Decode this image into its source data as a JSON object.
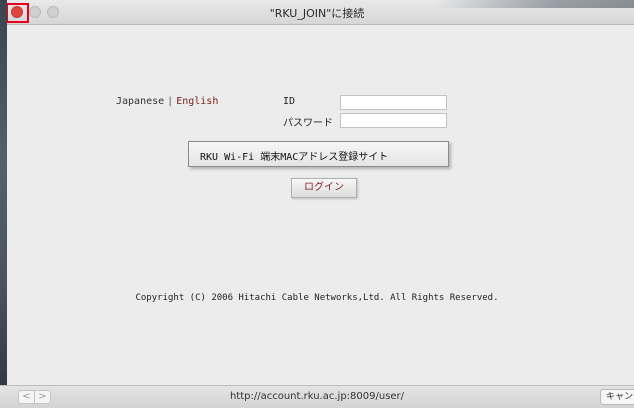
{
  "window": {
    "title": "\"RKU_JOIN\"に接続"
  },
  "language": {
    "japanese": "Japanese",
    "separator": "|",
    "english": "English"
  },
  "form": {
    "id_label": "ID",
    "password_label": "パスワード",
    "id_value": "",
    "password_value": ""
  },
  "site_select": {
    "selected": "RKU Wi-Fi 端末MACアドレス登録サイト"
  },
  "login_button": "ログイン",
  "footer": {
    "copyright": "Copyright (C) 2006 Hitachi Cable Networks,Ltd. All Rights Reserved."
  },
  "statusbar": {
    "url": "http://account.rku.ac.jp:8009/user/",
    "back": "<",
    "forward": ">",
    "cancel": "キャンセル"
  },
  "colors": {
    "close_button": "#e0443e",
    "highlight": "#e8001e",
    "login_text": "#8a1f2a",
    "english_link": "#7a1f1f"
  }
}
